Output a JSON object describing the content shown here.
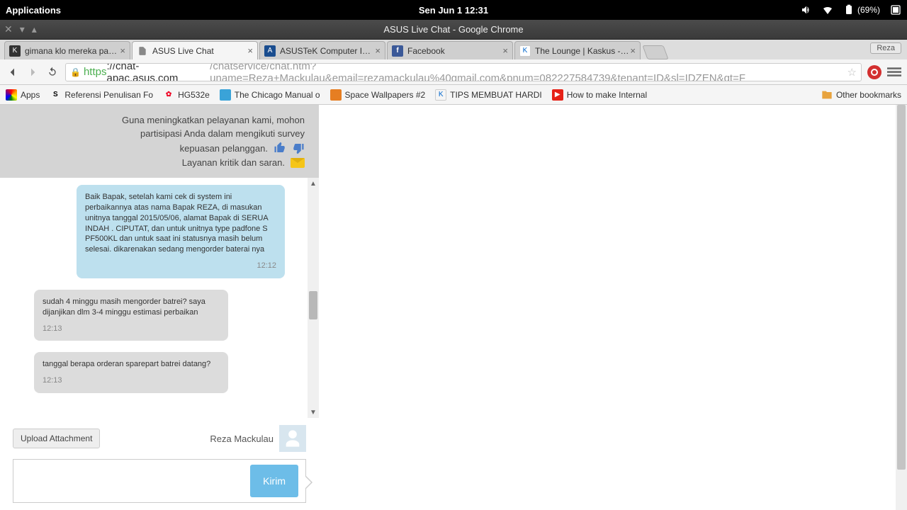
{
  "gnome": {
    "apps": "Applications",
    "clock": "Sen Jun 1   12:31",
    "battery": "(69%)"
  },
  "window": {
    "title": "ASUS Live Chat - Google Chrome"
  },
  "tabs": [
    {
      "label": "gimana klo mereka pacar"
    },
    {
      "label": "ASUS Live Chat"
    },
    {
      "label": "ASUSTeK Computer Inc. -S"
    },
    {
      "label": "Facebook"
    },
    {
      "label": "The Lounge | Kaskus - The"
    }
  ],
  "user_badge": "Reza",
  "url": {
    "scheme": "https",
    "host": "://chat-apac.asus.com",
    "path": "/chatservice/chat.htm?uname=Reza+Mackulau&email=rezamackulau%40gmail.com&pnum=082227584739&tenant=ID&sl=IDZEN&qt=F"
  },
  "bookmarks": {
    "apps": "Apps",
    "items": [
      "Referensi Penulisan Fo",
      "HG532e",
      "The Chicago Manual o",
      "Space Wallpapers #2",
      "TIPS MEMBUAT HARDI",
      "How to make Internal"
    ],
    "other": "Other bookmarks"
  },
  "survey": {
    "line1": "Guna meningkatkan pelayanan kami, mohon",
    "line2": "partisipasi Anda dalam mengikuti survey",
    "line3": "kepuasan pelanggan.",
    "line4": "Layanan kritik dan saran."
  },
  "messages": [
    {
      "from": "agent",
      "text": "Baik Bapak, setelah kami cek di system ini perbaikannya atas nama Bapak REZA, di masukan unitnya tanggal 2015/05/06, alamat Bapak di SERUA INDAH . CIPUTAT, dan untuk unitnya type padfone S PF500KL dan untuk saat ini statusnya masih belum selesai. dikarenakan sedang mengorder baterai nya",
      "time": "12:12"
    },
    {
      "from": "user",
      "text": "sudah 4 minggu masih mengorder batrei? saya dijanjikan dlm 3-4 minggu estimasi perbaikan",
      "time": "12:13"
    },
    {
      "from": "user",
      "text": "tanggal berapa orderan sparepart batrei datang?",
      "time": "12:13"
    }
  ],
  "footer": {
    "upload": "Upload Attachment",
    "username": "Reza Mackulau",
    "send": "Kirim"
  }
}
